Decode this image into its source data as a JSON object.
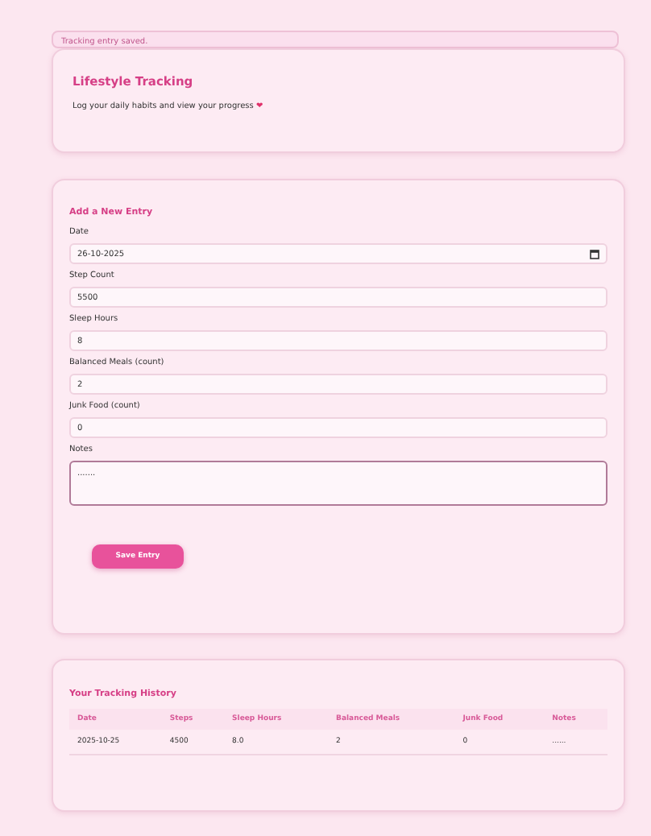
{
  "alert": {
    "text": "Tracking entry saved."
  },
  "header": {
    "title": "Lifestyle Tracking",
    "subtitle": "Log your daily habits and view your progress",
    "emoji": "❤"
  },
  "form": {
    "title": "Add a New Entry",
    "fields": [
      {
        "kind": "date",
        "label": "Date",
        "value": "26-10-2025"
      },
      {
        "kind": "text",
        "label": "Step Count",
        "value": "5500"
      },
      {
        "kind": "text",
        "label": "Sleep Hours",
        "value": "8"
      },
      {
        "kind": "text",
        "label": "Balanced Meals (count)",
        "value": "2"
      },
      {
        "kind": "text",
        "label": "Junk Food (count)",
        "value": "0"
      },
      {
        "kind": "textarea",
        "label": "Notes",
        "value": "......."
      }
    ],
    "button": "Save Entry"
  },
  "history": {
    "title": "Your Tracking History",
    "columns": [
      "Date",
      "Steps",
      "Sleep Hours",
      "Balanced Meals",
      "Junk Food",
      "Notes"
    ],
    "rows": [
      [
        "2025-10-25",
        "4500",
        "8.0",
        "2",
        "0",
        "......"
      ]
    ]
  }
}
